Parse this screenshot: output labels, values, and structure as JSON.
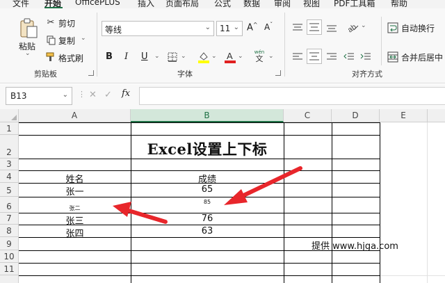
{
  "menu": {
    "items": [
      "文件",
      "开始",
      "OfficePLUS",
      "插入",
      "页面布局",
      "公式",
      "数据",
      "审阅",
      "视图",
      "PDF工具箱",
      "帮助"
    ],
    "active": "开始"
  },
  "ribbon": {
    "clipboard": {
      "paste": "粘贴",
      "cut": "剪切",
      "copy": "复制",
      "format_painter": "格式刷",
      "label": "剪贴板"
    },
    "font": {
      "name": "等线",
      "size": "11",
      "grow": "A^",
      "shrink": "A˅",
      "bold": "B",
      "italic": "I",
      "underline": "U",
      "phonetic": "wén",
      "phonetic_char": "文",
      "label": "字体",
      "font_color": "#e02020",
      "fill_color": "#ffff00"
    },
    "alignment": {
      "wrap_text": "自动换行",
      "merge_center": "合并后居中",
      "label": "对齐方式"
    }
  },
  "formula_bar": {
    "name_box": "B13",
    "cancel": "✕",
    "enter": "✓",
    "fx": "fx",
    "content": ""
  },
  "sheet": {
    "columns": [
      "A",
      "B",
      "C",
      "D",
      "E"
    ],
    "selected_column": "B",
    "rows": [
      "1",
      "2",
      "3",
      "4",
      "5",
      "6",
      "7",
      "8",
      "9",
      "10",
      "11"
    ],
    "title": "Excel设置上下标",
    "header_name": "姓名",
    "header_score": "成绩",
    "records": [
      {
        "name": "张一",
        "score": "65"
      },
      {
        "name": "张二",
        "score": "85"
      },
      {
        "name": "张三",
        "score": "76"
      },
      {
        "name": "张四",
        "score": "63"
      }
    ],
    "credit": "提供 www.hjga.com"
  },
  "annotation_color": "#e8262b"
}
